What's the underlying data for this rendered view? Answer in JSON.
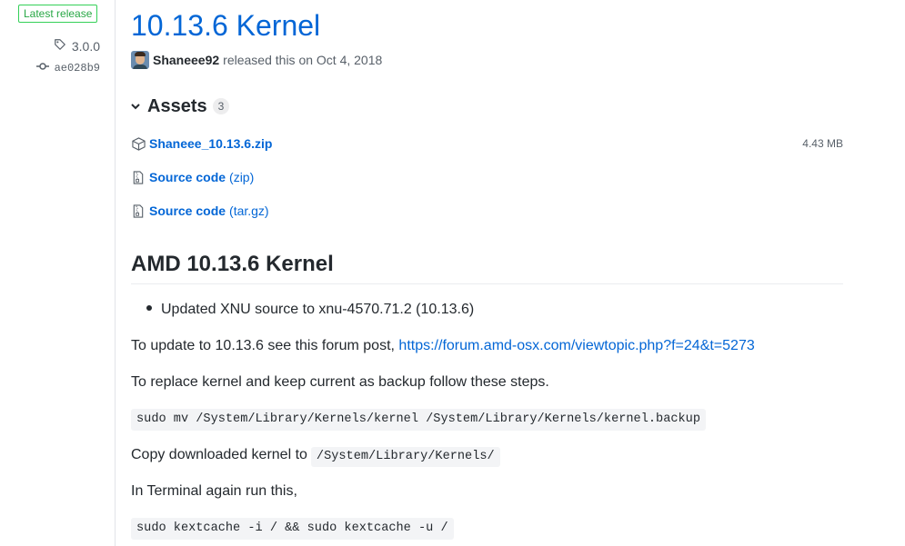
{
  "sidebar": {
    "badge": "Latest release",
    "tag": "3.0.0",
    "commit": "ae028b9"
  },
  "release": {
    "title": "10.13.6 Kernel",
    "author": "Shaneee92",
    "released_text": "released this on Oct 4, 2018"
  },
  "assets": {
    "header": "Assets",
    "count": "3",
    "items": [
      {
        "name": "Shaneee_10.13.6.zip",
        "sub": "",
        "size": "4.43 MB",
        "icon": "package-icon"
      },
      {
        "name": "Source code",
        "sub": "(zip)",
        "size": "",
        "icon": "file-zip-icon"
      },
      {
        "name": "Source code",
        "sub": "(tar.gz)",
        "size": "",
        "icon": "file-zip-icon"
      }
    ]
  },
  "body": {
    "heading": "AMD 10.13.6 Kernel",
    "bullet": "Updated XNU source to xnu-4570.71.2 (10.13.6)",
    "update_text": "To update to 10.13.6 see this forum post,",
    "forum_link": "https://forum.amd-osx.com/viewtopic.php?f=24&t=5273",
    "replace_text": "To replace kernel and keep current as backup follow these steps.",
    "code_backup": "sudo mv /System/Library/Kernels/kernel /System/Library/Kernels/kernel.backup",
    "copy_text": "Copy downloaded kernel to",
    "copy_path": "/System/Library/Kernels/",
    "terminal_text": "In Terminal again run this,",
    "code_kextcache": "sudo kextcache -i / && sudo kextcache -u /"
  }
}
